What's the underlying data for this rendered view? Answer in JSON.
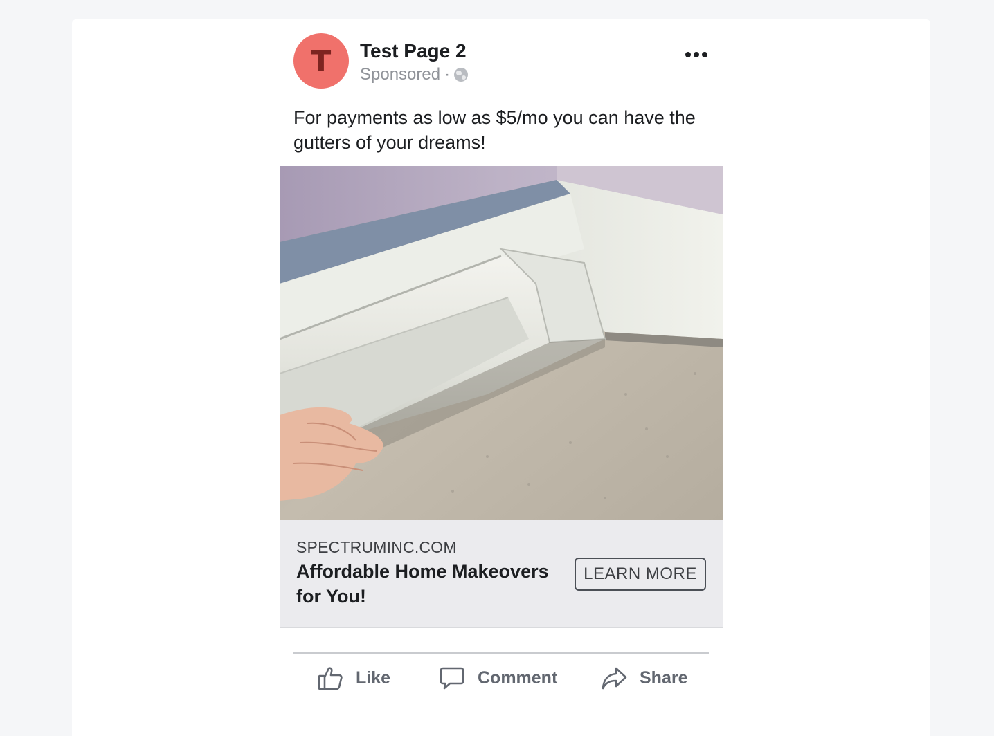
{
  "post": {
    "avatar_letter": "T",
    "page_name": "Test Page 2",
    "sponsored_label": "Sponsored",
    "separator": "·",
    "privacy_icon": "globe-icon",
    "more_icon": "more-options-icon",
    "text": "For payments as low as $5/mo you can have the gutters of your dreams!"
  },
  "image": {
    "subject": "hand-holding-white-rain-gutter-under-roof-eave"
  },
  "link_preview": {
    "domain": "SPECTRUMINC.COM",
    "headline": "Affordable Home Makeovers for You!",
    "cta_label": "LEARN MORE"
  },
  "actions": [
    {
      "label": "Like",
      "icon": "thumbs-up-icon"
    },
    {
      "label": "Comment",
      "icon": "comment-bubble-icon"
    },
    {
      "label": "Share",
      "icon": "share-arrow-icon"
    }
  ],
  "colors": {
    "avatar": "#f0716b",
    "avatar_letter": "#7d2420",
    "link_box_bg": "#ebebee",
    "action_text": "#626770",
    "page_bg": "#f5f6f8"
  }
}
